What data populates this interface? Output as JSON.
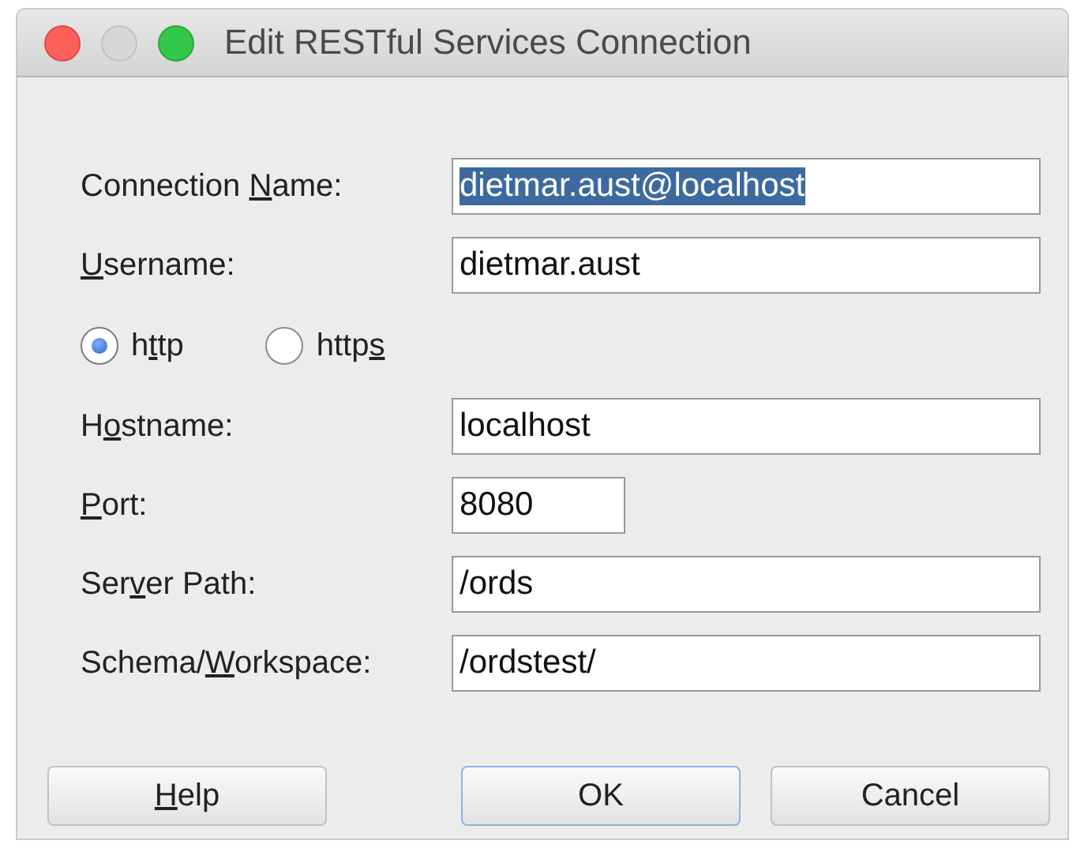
{
  "window": {
    "title": "Edit RESTful Services Connection"
  },
  "fields_top": [
    {
      "label": {
        "before": "Connection ",
        "key": "N",
        "after": "ame:"
      },
      "value": "dietmar.aust@localhost",
      "text_selected": true,
      "kind": "wide"
    },
    {
      "label": {
        "key": "U",
        "after": "sername:"
      },
      "value": "dietmar.aust",
      "text_selected": false,
      "kind": "wide"
    }
  ],
  "protocols": [
    {
      "label": {
        "before": "h",
        "key": "t",
        "after": "tp"
      },
      "selected": true
    },
    {
      "label": {
        "before": "http",
        "key": "s"
      },
      "selected": false
    }
  ],
  "fields_bottom": [
    {
      "label": {
        "before": "H",
        "key": "o",
        "after": "stname:"
      },
      "value": "localhost",
      "text_selected": false,
      "kind": "wide"
    },
    {
      "label": {
        "key": "P",
        "after": "ort:"
      },
      "value": "8080",
      "text_selected": false,
      "kind": "short"
    },
    {
      "label": {
        "before": "Ser",
        "key": "v",
        "after": "er Path:"
      },
      "value": "/ords",
      "text_selected": false,
      "kind": "wide"
    },
    {
      "label": {
        "before": "Schema/",
        "key": "W",
        "after": "orkspace:"
      },
      "value": "/ordstest/",
      "text_selected": false,
      "kind": "wide"
    }
  ],
  "buttons": [
    {
      "label": {
        "key": "H",
        "after": "elp"
      },
      "default": false,
      "kind": "help"
    },
    {
      "label": {
        "before": "OK"
      },
      "default": true,
      "kind": "ok"
    },
    {
      "label": {
        "before": "Cancel"
      },
      "default": false,
      "kind": "cancel"
    }
  ]
}
